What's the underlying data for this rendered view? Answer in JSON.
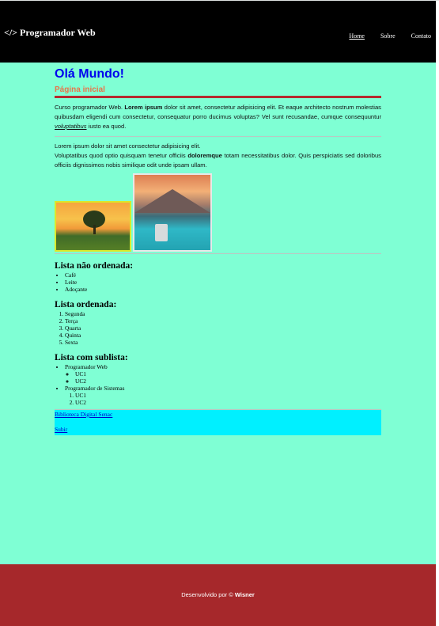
{
  "header": {
    "logo": "</> Programador Web",
    "nav": [
      "Home",
      "Sobre",
      "Contato"
    ]
  },
  "main": {
    "title": "Olá Mundo!",
    "subtitle": "Página inicial",
    "para1": {
      "start": "Curso programador Web. ",
      "bold": "Lorem ipsum",
      "mid": " dolor sit amet, consectetur adipisicing elit. Et eaque architecto nostrum molestias quibusdam eligendi cum consectetur, consequatur porro ducimus voluptas? Vel sunt recusandae, cumque consequuntur ",
      "italic": "voluptatibus",
      "end": " iusto ea quod."
    },
    "para2": {
      "line1": "Lorem ipsum dolor sit amet consectetur adipisicing elit.",
      "start": "Voluptatibus quod optio quisquam tenetur officiis ",
      "bold": "doloremque",
      "end": " totam necessitatibus dolor. Quis perspiciatis sed doloribus officiis dignissimos nobis similique odit unde ipsam ullam."
    },
    "unordered_title": "Lista não ordenada:",
    "unordered": [
      "Café",
      "Leite",
      "Adoçante"
    ],
    "ordered_title": "Lista ordenada:",
    "ordered": [
      "Segunda",
      "Terça",
      "Quarta",
      "Quinta",
      "Sexta"
    ],
    "sublist_title": "Lista com sublista:",
    "sublist": [
      {
        "label": "Programador Web",
        "items": [
          "UC1",
          "UC2"
        ]
      },
      {
        "label": "Programador de Sistemas",
        "items": [
          "UC1",
          "UC2"
        ]
      }
    ],
    "link1": "Biblioteca Digital Senac",
    "link2": "Subir"
  },
  "footer": {
    "text": "Desenvolvido por © ",
    "author": "Wisner"
  },
  "colors": {
    "background": "#7fffd4",
    "header": "#000000",
    "footer": "#a6282b",
    "title": "#0000ee",
    "subtitle": "#e8744a",
    "linkbar": "#00f0ff"
  }
}
